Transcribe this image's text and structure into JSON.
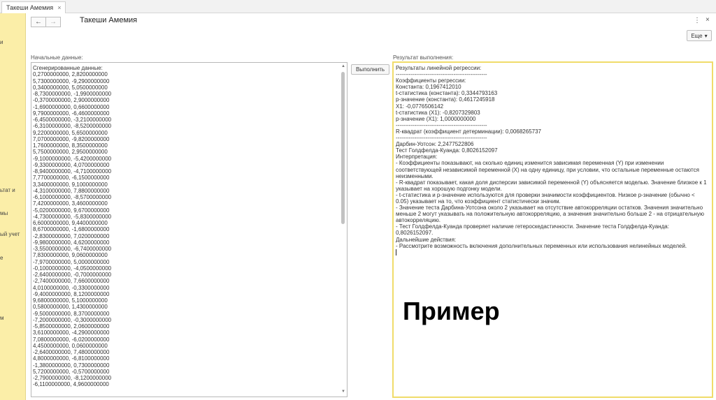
{
  "tab": {
    "title": "Такеши Амемия",
    "close": "×"
  },
  "sidebar": {
    "fragments": [
      "и",
      "ьтат и",
      "мы",
      "ый учет",
      "е",
      "м"
    ]
  },
  "header": {
    "back": "←",
    "forward": "→",
    "title": "Такеши Амемия",
    "kebab": "⋮",
    "close": "×",
    "more_label": "Еще",
    "more_arrow": "▾"
  },
  "input": {
    "label": "Начальные данные:",
    "text": "Сгенерированные данные:\n0,2700000000, 2,8200000000\n5,7300000000, -9,2900000000\n0,3400000000, 5,0500000000\n-8,7300000000, -1,9900000000\n-0,3700000000, 2,9000000000\n-1,6900000000, 0,6600000000\n9,7900000000, -6,4600000000\n-6,4500000000, -3,2100000000\n-6,3100000000, -8,5200000000\n9,2200000000, 5,6500000000\n7,0700000000, -9,8200000000\n1,7600000000, 8,3500000000\n5,7500000000, 2,9500000000\n-9,1000000000, -5,4200000000\n-9,3300000000, 4,0700000000\n-8,9400000000, -4,7100000000\n7,7700000000, -6,1500000000\n3,3400000000, 9,1000000000\n-4,3100000000, 7,8800000000\n-6,1000000000, -8,5700000000\n7,4200000000, 3,4600000000\n-5,0200000000, 9,6700000000\n-4,7300000000, -5,8300000000\n6,6000000000, 9,4400000000\n8,6700000000, -1,6800000000\n-2,8300000000, 7,0200000000\n-9,9800000000, 4,6200000000\n-3,5500000000, -6,7400000000\n7,8300000000, 9,0600000000\n-7,9700000000, 5,0000000000\n-0,1000000000, -4,0500000000\n-2,6400000000, -0,7000000000\n-2,7400000000, 7,6600000000\n4,0100000000, -0,3300000000\n-9,4000000000, 8,1200000000\n9,6800000000, 5,1000000000\n0,5800000000, 1,4300000000\n-9,5000000000, 8,3700000000\n-7,2000000000, -0,3000000000\n-5,8500000000, 2,0600000000\n3,6100000000, -4,2900000000\n7,0800000000, -6,0200000000\n4,4500000000, 0,0600000000\n-2,6400000000, 7,4800000000\n4,8000000000, -6,8100000000\n-1,3800000000, 0,7300000000\n5,7200000000, -0,5700000000\n-2,7900000000, -8,1200000000\n-6,1100000000, 4,9600000000"
  },
  "run_button": {
    "label": "Выполнить"
  },
  "result": {
    "label": "Результат выполнения:",
    "text": "Результаты линейной регрессии:\n-------------------------------------------------\nКоэффициенты регрессии:\nКонстанта: 0,1967412010\nt-статистика (константа): 0,3344793163\np-значение (константа): 0,4617245918\nX1: -0,0776506142\nt-статистика (X1): -0,8207329803\np-значение (X1): 1,0000000000\n-------------------------------------------------\nR-квадрат (коэффициент детерминации): 0,0068265737\n-------------------------------------------------\nДарбин-Уотсон: 2,2477522806\nТест Голдфелда-Куанда: 0,8026152097\nИнтерпретация:\n- Коэффициенты показывают, на сколько единиц изменится зависимая переменная (Y) при изменении соответствующей независимой переменной (X) на одну единицу, при условии, что остальные переменные остаются неизменными.\n- R-квадрат показывает, какая доля дисперсии зависимой переменной (Y) объясняется моделью. Значение близкое к 1 указывает на хорошую подгонку модели.\n- t-статистика и p-значение используются для проверки значимости коэффициентов. Низкое p-значение (обычно < 0.05) указывает на то, что коэффициент статистически значим.\n- Значение теста Дарбина-Уотсона около 2 указывает на отсутствие автокорреляции остатков. Значения значительно меньше 2 могут указывать на положительную автокорреляцию, а значения значительно больше 2 - на отрицательную автокорреляцию.\n- Тест Голдфелда-Куанда проверяет наличие гетероскедастичности. Значение теста Голдфелда-Куанда: 0,8026152097.\nДальнейшие действия:\n- Рассмотрите возможность включения дополнительных переменных или использования нелинейных моделей."
  },
  "watermark": "Пример",
  "colors": {
    "sidebar_bg": "#fbeea8",
    "result_border": "#f0dc6a"
  }
}
